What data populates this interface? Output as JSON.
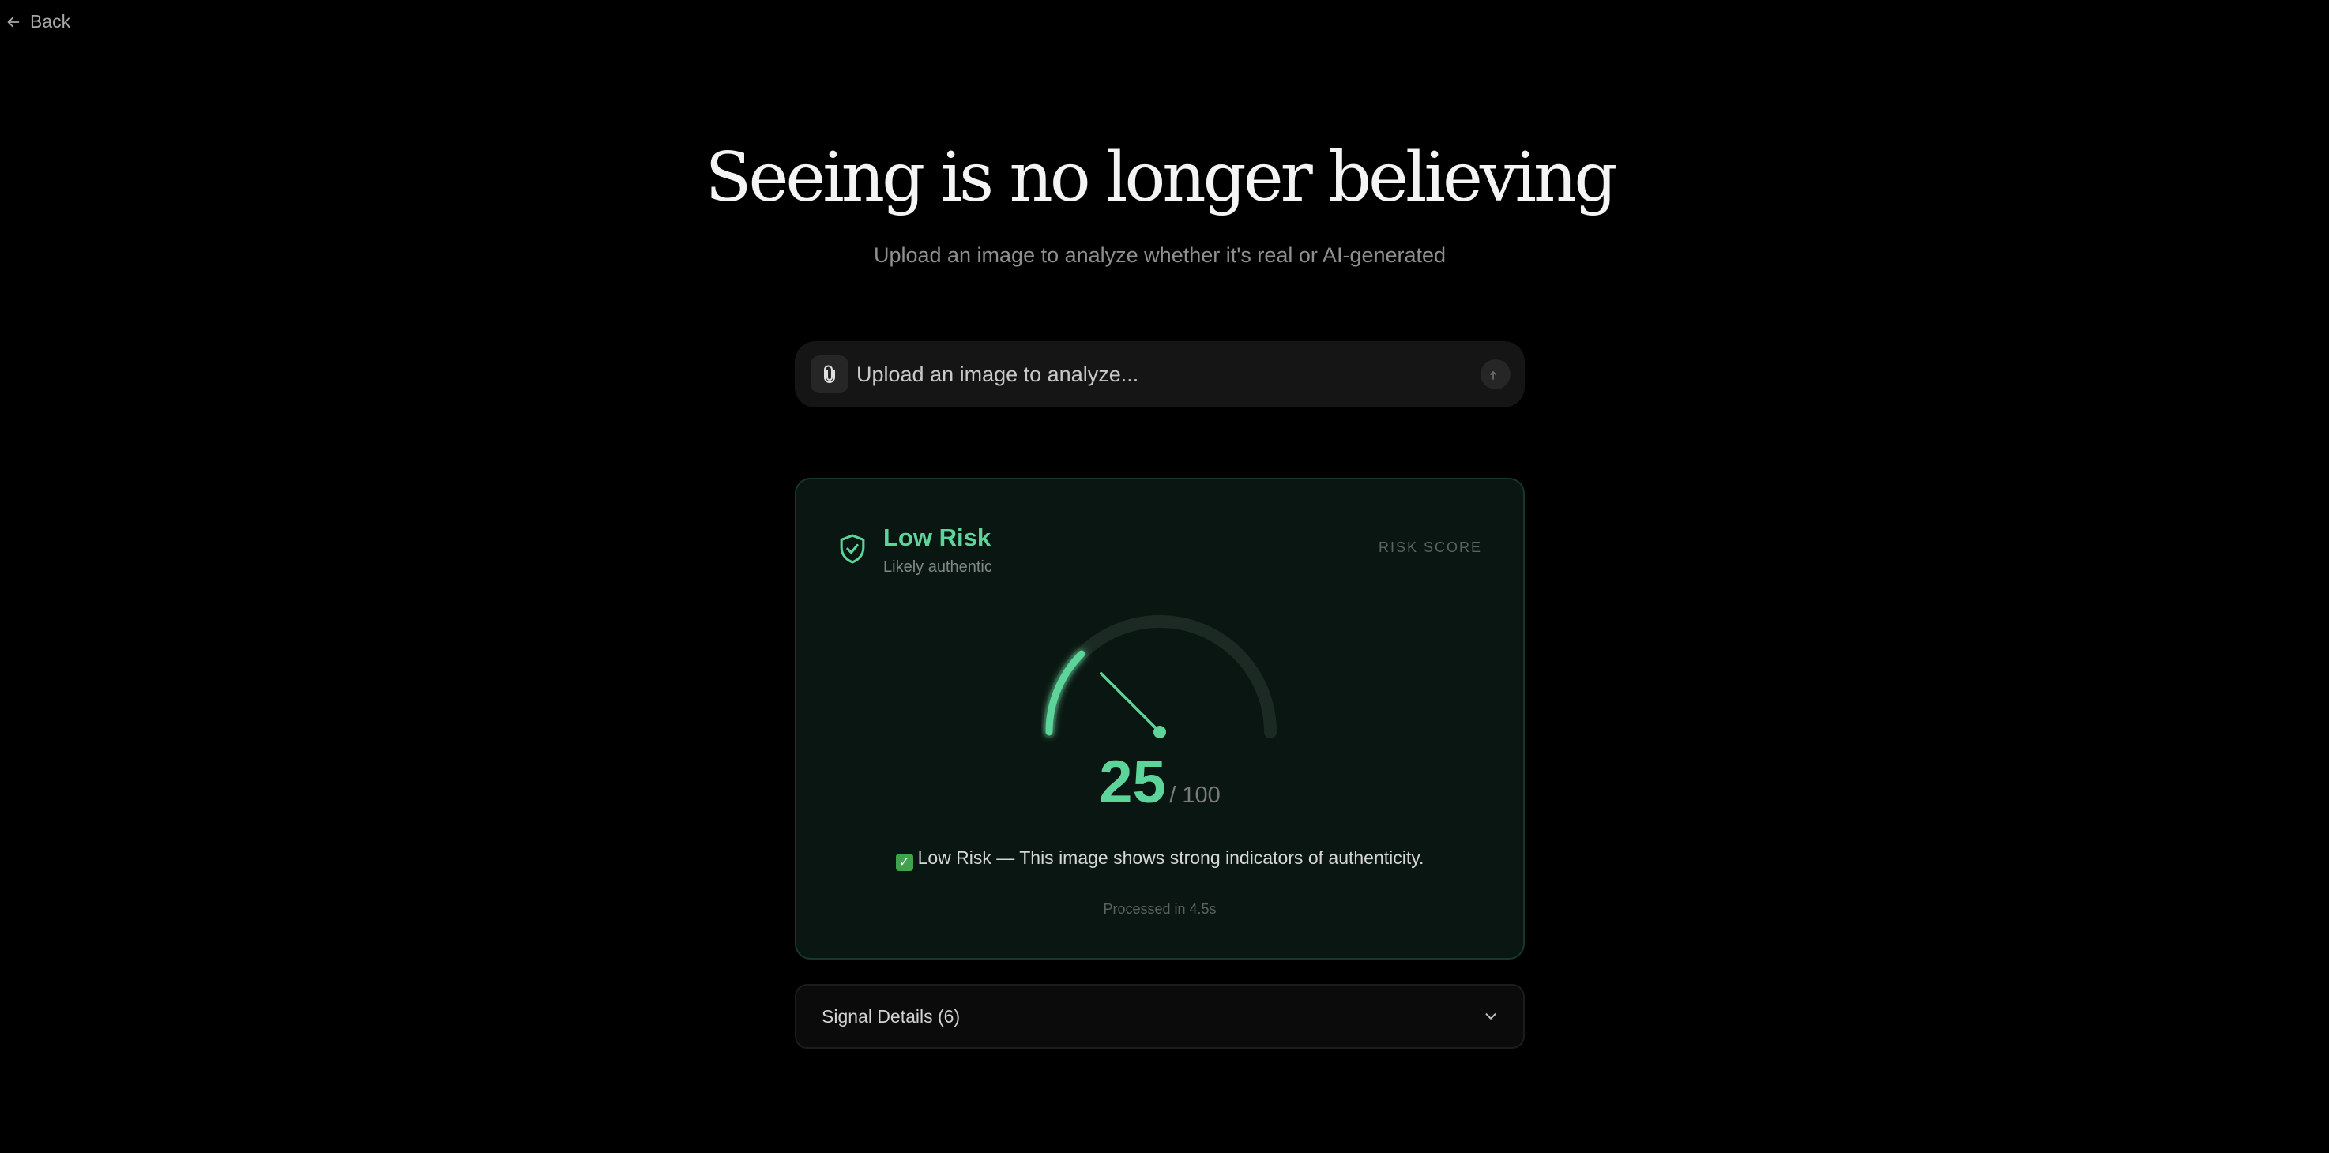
{
  "nav": {
    "back_label": "Back",
    "back_icon": "arrow-left-icon"
  },
  "hero": {
    "title": "Seeing is no longer believing",
    "subtitle": "Upload an image to analyze whether it's real or AI-generated"
  },
  "upload": {
    "placeholder": "Upload an image to analyze...",
    "attach_icon": "paperclip-icon",
    "send_icon": "arrow-up-icon"
  },
  "result": {
    "risk_level": "Low Risk",
    "risk_description": "Likely authentic",
    "score_label": "RISK SCORE",
    "score": 25,
    "score_max": "/ 100",
    "verdict_text": "Low Risk — This image shows strong indicators of authenticity.",
    "verdict_icon": "check-box-icon",
    "processed_text": "Processed in 4.5s",
    "shield_icon": "shield-check-icon",
    "accent_color": "#5dd49a"
  },
  "signals": {
    "label": "Signal Details (6)",
    "expand_icon": "chevron-down-icon"
  }
}
